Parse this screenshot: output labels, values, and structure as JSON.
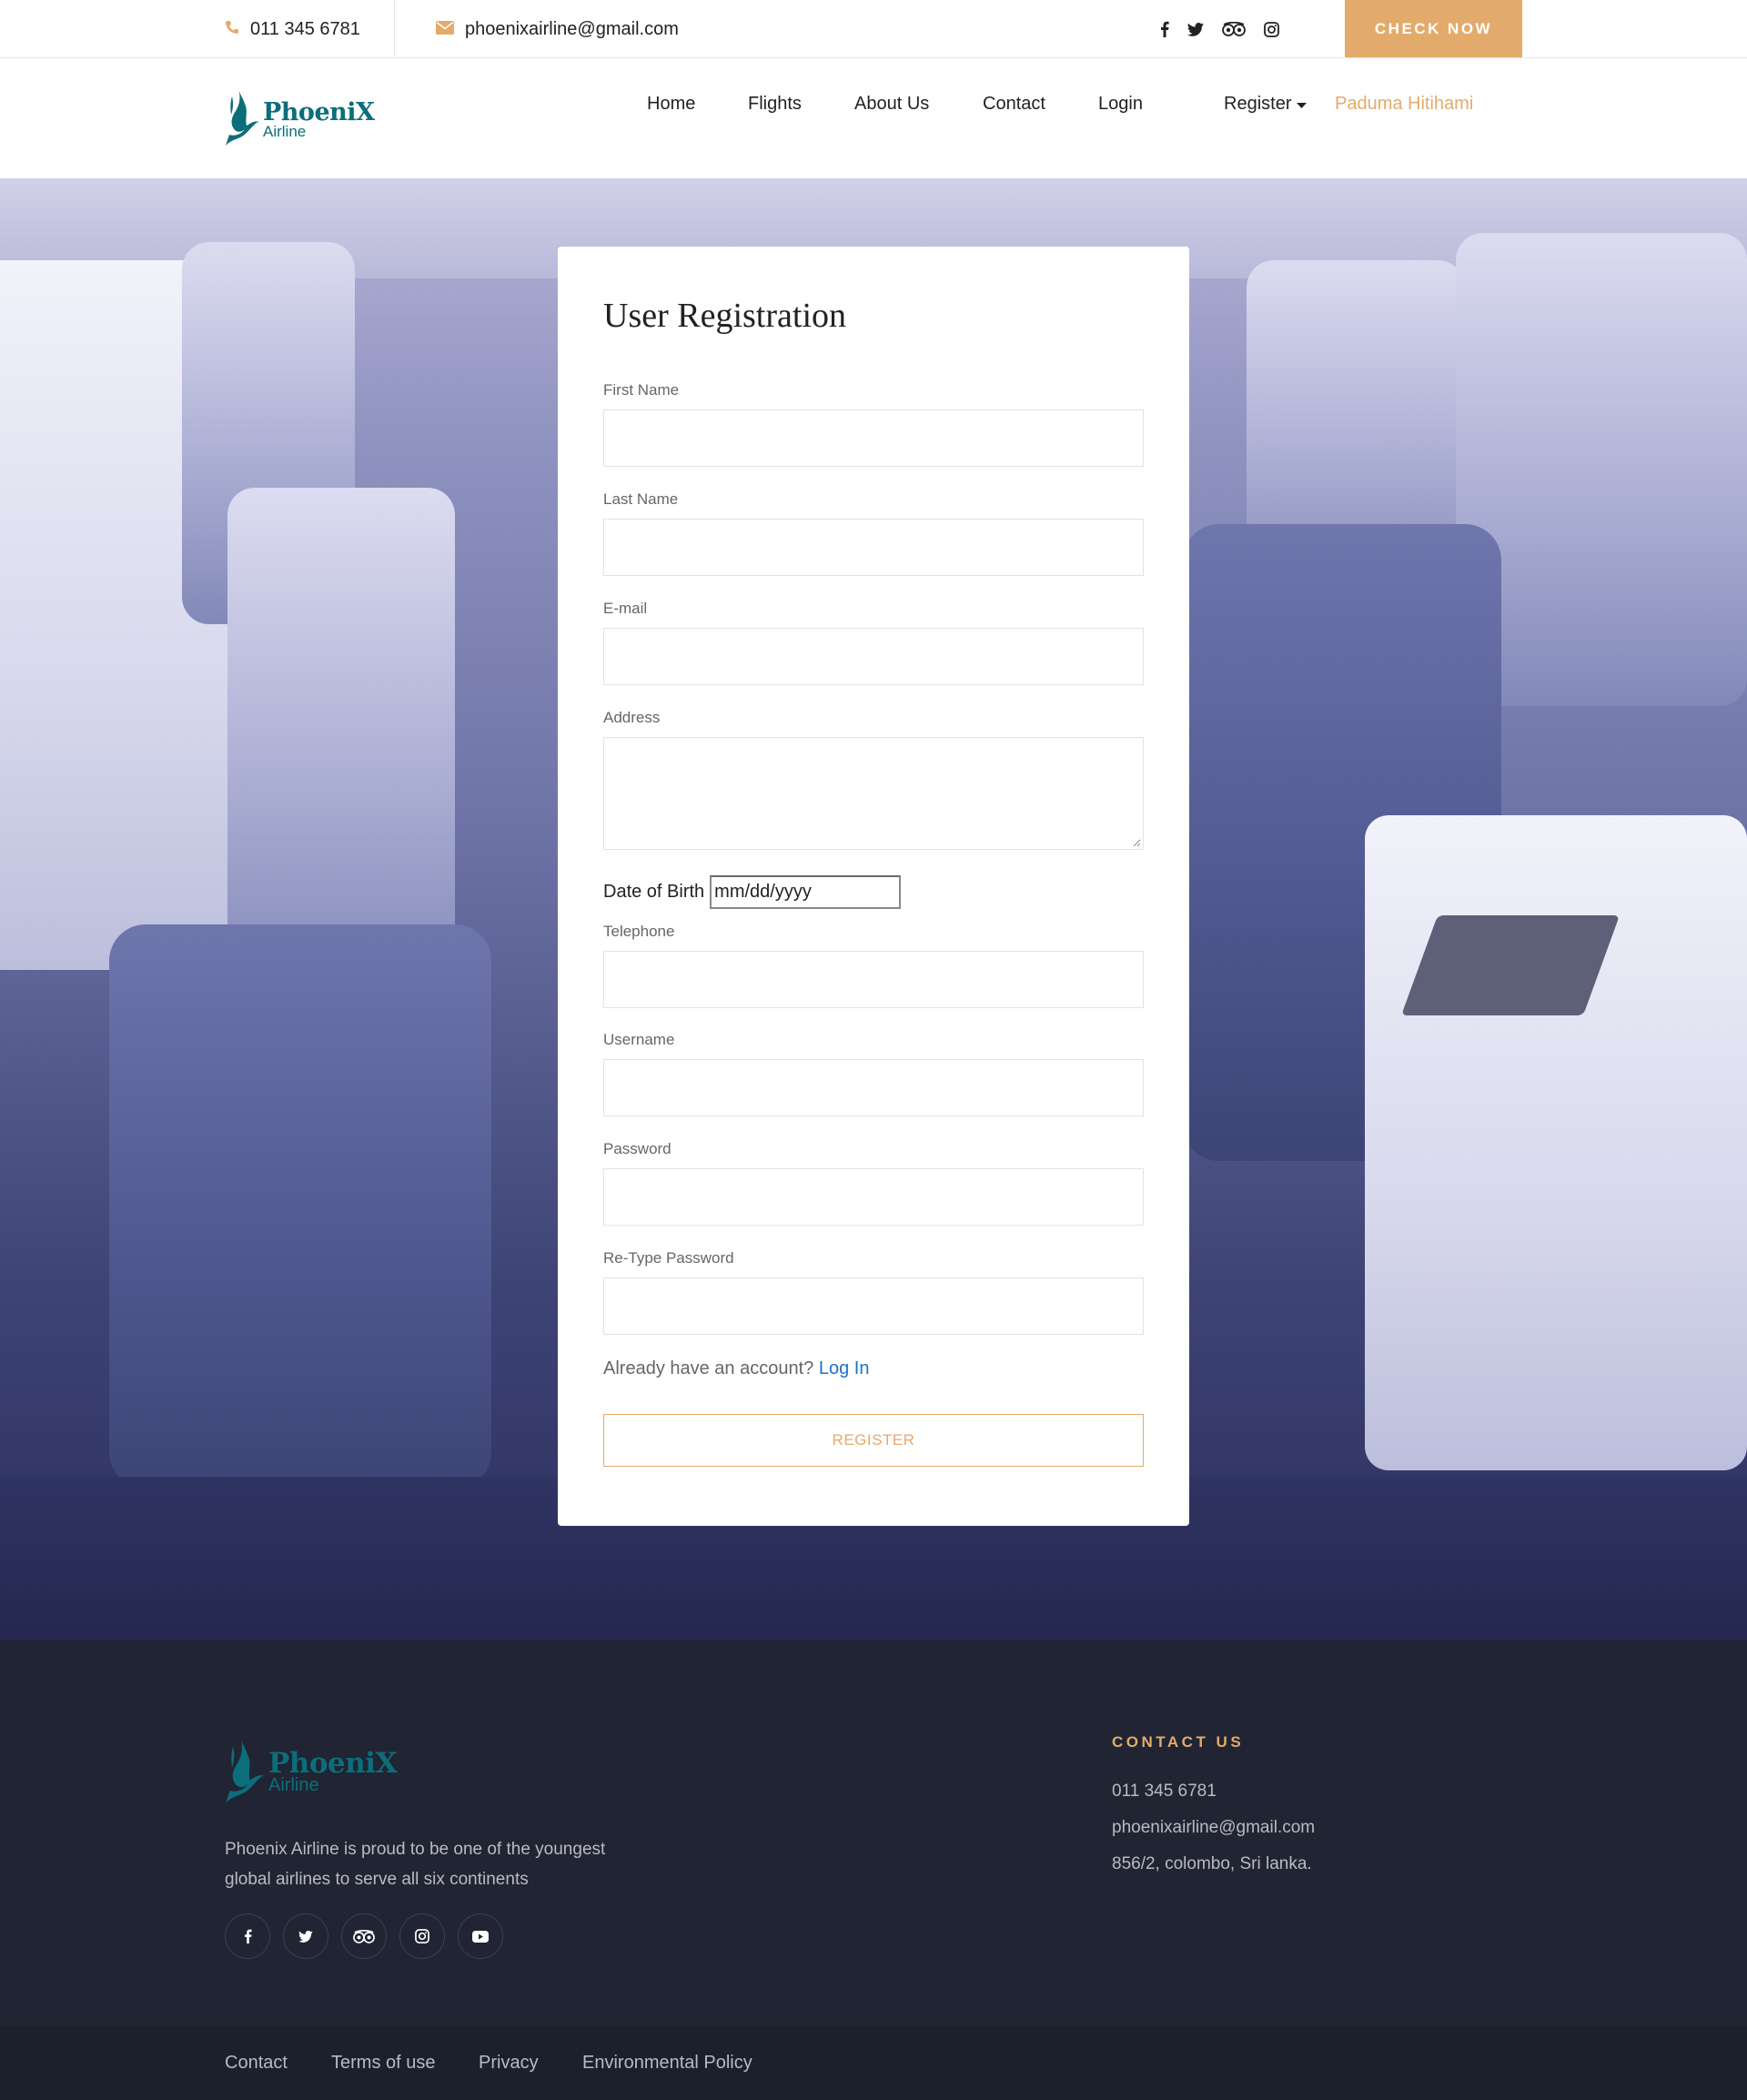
{
  "topbar": {
    "phone": "011 345 6781",
    "email": "phoenixairline@gmail.com",
    "social_icons": [
      "facebook-icon",
      "twitter-icon",
      "tripadvisor-icon",
      "instagram-icon"
    ],
    "cta_label": "CHECK NOW"
  },
  "brand": {
    "name": "PhoeniX",
    "subtitle": "Airline",
    "color": "#0c6e7a",
    "accent": "#e3ab6b"
  },
  "nav": {
    "items": [
      {
        "label": "Home"
      },
      {
        "label": "Flights"
      },
      {
        "label": "About Us"
      },
      {
        "label": "Contact"
      },
      {
        "label": "Login"
      },
      {
        "label": "Register"
      }
    ],
    "user": "Paduma Hitihami"
  },
  "form": {
    "title": "User Registration",
    "first_name_label": "First Name",
    "last_name_label": "Last Name",
    "email_label": "E-mail",
    "address_label": "Address",
    "dob_label": "Date of Birth",
    "dob_placeholder": "mm/dd/yyyy",
    "telephone_label": "Telephone",
    "username_label": "Username",
    "password_label": "Password",
    "retype_password_label": "Re-Type Password",
    "already_text": "Already have an account?",
    "login_link": "Log In",
    "register_button": "REGISTER"
  },
  "footer": {
    "brand_name": "PhoeniX",
    "brand_subtitle": "Airline",
    "about": "Phoenix Airline is proud to be one of the youngest global airlines to serve all six continents",
    "social_icons": [
      "facebook-icon",
      "twitter-icon",
      "tripadvisor-icon",
      "instagram-icon",
      "youtube-icon"
    ],
    "contact_title": "CONTACT US",
    "contact_phone": "011 345 6781",
    "contact_email": "phoenixairline@gmail.com",
    "contact_address": "856/2, colombo, Sri lanka.",
    "links": [
      {
        "label": "Contact"
      },
      {
        "label": "Terms of use"
      },
      {
        "label": "Privacy"
      },
      {
        "label": "Environmental Policy"
      }
    ]
  }
}
